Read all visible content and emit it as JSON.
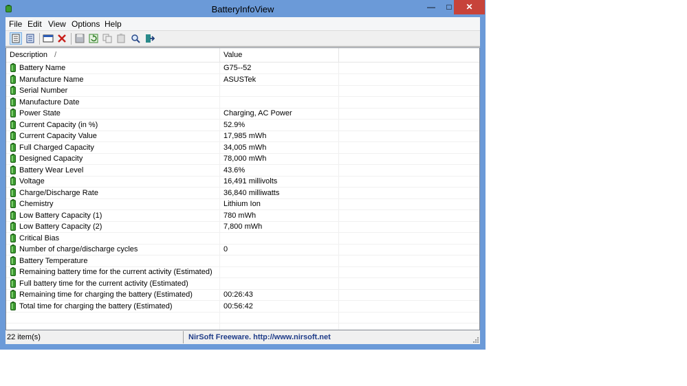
{
  "window": {
    "title": "BatteryInfoView"
  },
  "menu": [
    "File",
    "Edit",
    "View",
    "Options",
    "Help"
  ],
  "toolbar_icons": [
    "html-report-selected-icon",
    "html-report-all-icon",
    "properties-icon",
    "delete-icon",
    "save-icon",
    "refresh-icon",
    "copy-icon",
    "paste-icon",
    "find-icon",
    "exit-icon"
  ],
  "columns": {
    "description": "Description",
    "value": "Value",
    "sort_indicator": "/"
  },
  "rows": [
    {
      "desc": "Battery Name",
      "value": "G75--52"
    },
    {
      "desc": "Manufacture Name",
      "value": "ASUSTek"
    },
    {
      "desc": "Serial Number",
      "value": ""
    },
    {
      "desc": "Manufacture Date",
      "value": ""
    },
    {
      "desc": "Power State",
      "value": "Charging, AC Power"
    },
    {
      "desc": "Current Capacity (in %)",
      "value": "52.9%"
    },
    {
      "desc": "Current Capacity Value",
      "value": "17,985 mWh"
    },
    {
      "desc": "Full Charged Capacity",
      "value": "34,005 mWh"
    },
    {
      "desc": "Designed Capacity",
      "value": "78,000 mWh"
    },
    {
      "desc": "Battery Wear Level",
      "value": "43.6%"
    },
    {
      "desc": "Voltage",
      "value": "16,491 millivolts"
    },
    {
      "desc": "Charge/Discharge Rate",
      "value": "36,840 milliwatts"
    },
    {
      "desc": "Chemistry",
      "value": "Lithium Ion"
    },
    {
      "desc": "Low Battery Capacity (1)",
      "value": "780 mWh"
    },
    {
      "desc": "Low Battery Capacity (2)",
      "value": "7,800 mWh"
    },
    {
      "desc": "Critical Bias",
      "value": ""
    },
    {
      "desc": "Number of charge/discharge cycles",
      "value": "0"
    },
    {
      "desc": "Battery Temperature",
      "value": ""
    },
    {
      "desc": "Remaining battery time for the current activity (Estimated)",
      "value": ""
    },
    {
      "desc": "Full battery time for the current activity (Estimated)",
      "value": ""
    },
    {
      "desc": "Remaining time for charging the battery (Estimated)",
      "value": "00:26:43"
    },
    {
      "desc": "Total  time for charging the battery (Estimated)",
      "value": "00:56:42"
    }
  ],
  "status": {
    "count": "22 item(s)",
    "credit": "NirSoft Freeware.  http://www.nirsoft.net"
  },
  "colors": {
    "frame": "#6b9ad8",
    "close": "#c7433a",
    "battery": "#3a9a2e",
    "credit": "#1f3c88"
  }
}
